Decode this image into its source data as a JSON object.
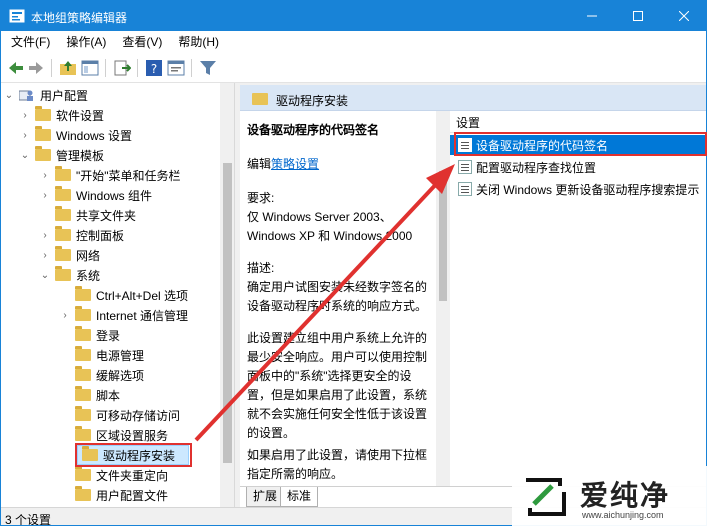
{
  "window": {
    "title": "本地组策略编辑器"
  },
  "menubar": [
    {
      "label": "文件(F)"
    },
    {
      "label": "操作(A)"
    },
    {
      "label": "查看(V)"
    },
    {
      "label": "帮助(H)"
    }
  ],
  "toolbar": {
    "icons": [
      "back-arrow-icon",
      "forward-arrow-icon",
      "folder-up-icon",
      "show-hide-tree-icon",
      "export-list-icon",
      "help-icon",
      "properties-icon",
      "filter-icon"
    ]
  },
  "tree": {
    "root": "用户配置",
    "items": [
      {
        "label": "软件设置"
      },
      {
        "label": "Windows 设置"
      },
      {
        "label": "管理模板"
      },
      {
        "label": "\"开始\"菜单和任务栏"
      },
      {
        "label": "Windows 组件"
      },
      {
        "label": "共享文件夹"
      },
      {
        "label": "控制面板"
      },
      {
        "label": "网络"
      },
      {
        "label": "系统"
      },
      {
        "label": "Ctrl+Alt+Del 选项"
      },
      {
        "label": "Internet 通信管理"
      },
      {
        "label": "登录"
      },
      {
        "label": "电源管理"
      },
      {
        "label": "缓解选项"
      },
      {
        "label": "脚本"
      },
      {
        "label": "可移动存储访问"
      },
      {
        "label": "区域设置服务"
      },
      {
        "label": "驱动程序安装"
      },
      {
        "label": "文件夹重定向"
      },
      {
        "label": "用户配置文件"
      }
    ],
    "selected": "驱动程序安装"
  },
  "rightpane": {
    "header": "驱动程序安装",
    "desc": {
      "heading": "设备驱动程序的代码签名",
      "edit_prefix": "编辑",
      "edit_link": "策略设置",
      "req_label": "要求:",
      "req_text": "仅 Windows Server 2003、Windows XP 和 Windows 2000",
      "desc_label": "描述:",
      "desc_text": "确定用户试图安装未经数字签名的设备驱动程序时系统的响应方式。",
      "para2": "此设置建立组中用户系统上允许的最少安全响应。用户可以使用控制面板中的\"系统\"选择更安全的设置，但是如果启用了此设置，系统就不会实施任何安全性低于该设置的设置。",
      "para3": "如果启用了此设置，请使用下拉框指定所需的响应。"
    },
    "settings": {
      "column_header": "设置",
      "rows": [
        {
          "label": "设备驱动程序的代码签名"
        },
        {
          "label": "配置驱动程序查找位置"
        },
        {
          "label": "关闭 Windows 更新设备驱动程序搜索提示"
        }
      ]
    },
    "tabs": [
      {
        "label": "扩展"
      },
      {
        "label": "标准"
      }
    ]
  },
  "statusbar": {
    "text": "3 个设置"
  },
  "watermark": {
    "brand": "爱纯净",
    "url": "www.aichunjing.com"
  },
  "colors": {
    "accent": "#1883d7",
    "selection": "#0078d7",
    "annotation": "#e0312f"
  }
}
